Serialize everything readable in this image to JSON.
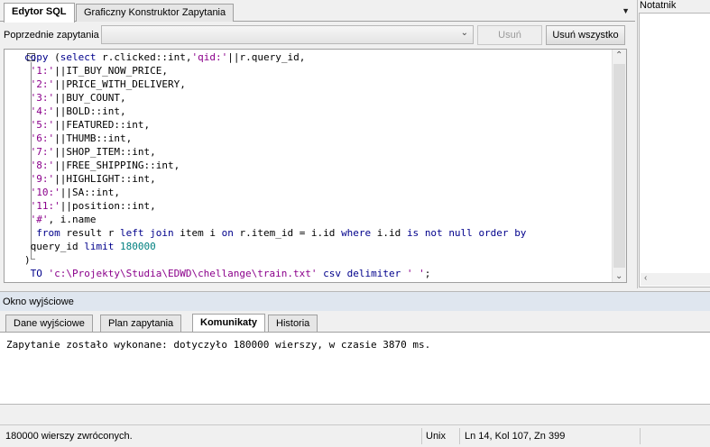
{
  "editor_tabs": [
    {
      "label": "Edytor SQL",
      "active": true
    },
    {
      "label": "Graficzny Konstruktor Zapytania",
      "active": false
    }
  ],
  "query_history": {
    "label": "Poprzednie zapytania",
    "selected": "",
    "remove_label": "Usuń",
    "remove_all_label": "Usuń wszystko"
  },
  "notepad": {
    "title": "Notatnik"
  },
  "sql_lines": [
    "copy (select r.clicked::int,'qid:'||r.query_id,",
    " '1:'||IT_BUY_NOW_PRICE,",
    " '2:'||PRICE_WITH_DELIVERY,",
    " '3:'||BUY_COUNT,",
    " '4:'||BOLD::int,",
    " '5:'||FEATURED::int,",
    " '6:'||THUMB::int,",
    " '7:'||SHOP_ITEM::int,",
    " '8:'||FREE_SHIPPING::int,",
    " '9:'||HIGHLIGHT::int,",
    " '10:'||SA::int,",
    " '11:'||position::int,",
    " '#', i.name",
    "  from result r left join item i on r.item_id = i.id where i.id is not null order by",
    " query_id limit 180000",
    ")",
    " TO 'c:\\Projekty\\Studia\\EDWD\\chellange\\train.txt' csv delimiter ' ';"
  ],
  "output_panel": {
    "title": "Okno wyjściowe",
    "tabs": [
      {
        "label": "Dane wyjściowe",
        "active": false
      },
      {
        "label": "Plan zapytania",
        "active": false
      },
      {
        "label": "Komunikaty",
        "active": true
      },
      {
        "label": "Historia",
        "active": false
      }
    ],
    "message": "Zapytanie zostało wykonane: dotyczyło 180000 wierszy, w czasie 3870 ms."
  },
  "status_bar": {
    "rows_returned": "180000 wierszy zwróconych.",
    "line_ending": "Unix",
    "cursor_position": "Ln 14, Kol 107, Zn 399"
  },
  "icons": {
    "tab_menu": "dropdown-triangle-icon",
    "scroll_up": "chevron-up-icon",
    "scroll_down": "chevron-down-icon",
    "fold": "collapse-minus-icon"
  }
}
